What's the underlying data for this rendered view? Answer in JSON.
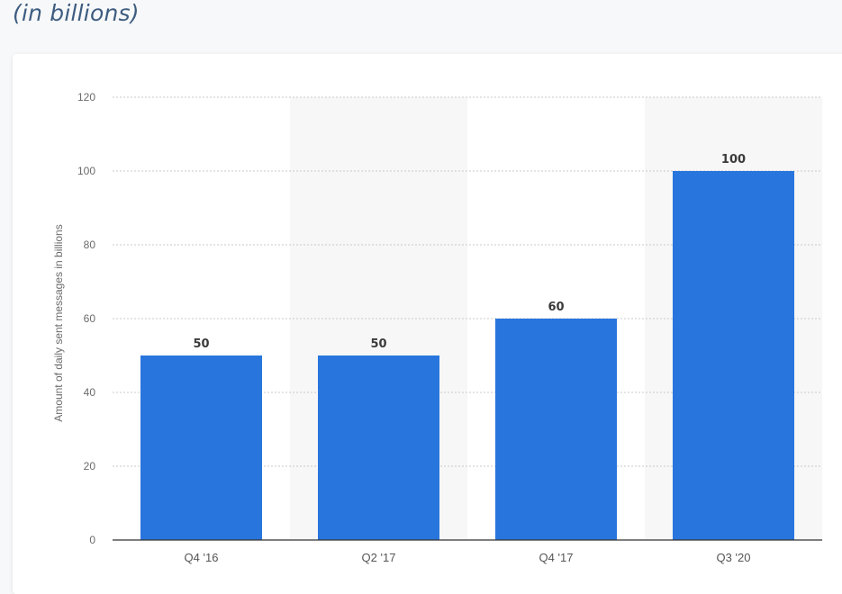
{
  "header": {
    "subtitle": "(in billions)"
  },
  "colors": {
    "bar": "#2876dd",
    "band": "#f7f7f7",
    "grid": "#c8c8c8",
    "axis": "#333333"
  },
  "chart_data": {
    "type": "bar",
    "categories": [
      "Q4 '16",
      "Q2 '17",
      "Q4 '17",
      "Q3 '20"
    ],
    "values": [
      50,
      50,
      60,
      100
    ],
    "data_labels": [
      "50",
      "50",
      "60",
      "100"
    ],
    "ylabel": "Amount of daily sent messages in billions",
    "xlabel": "",
    "ylim": [
      0,
      120
    ],
    "yticks": [
      0,
      20,
      40,
      60,
      80,
      100,
      120
    ],
    "grid": true,
    "legend": "none"
  }
}
